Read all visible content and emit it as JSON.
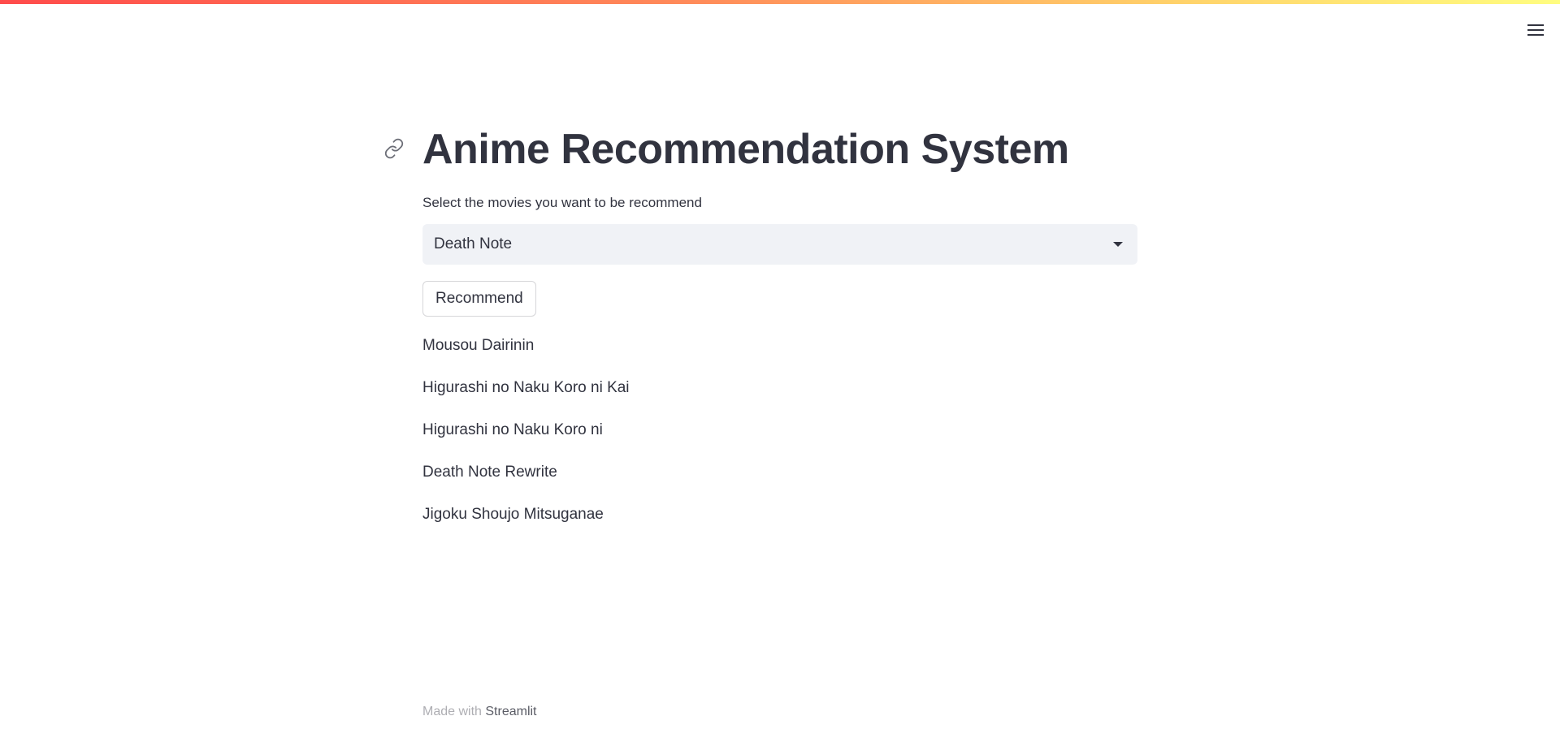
{
  "header": {
    "menu_icon": "hamburger-menu-icon",
    "gradient_colors": [
      "#ff4b4b",
      "#ff8c5a",
      "#ffd16a",
      "#fffd80"
    ]
  },
  "main": {
    "title": "Anime Recommendation System",
    "anchor_icon": "link-icon",
    "select_label": "Select the movies you want to be recommend",
    "select_value": "Death Note",
    "select_icon": "chevron-down-icon",
    "button_label": "Recommend",
    "results": [
      "Mousou Dairinin",
      "Higurashi no Naku Koro ni Kai",
      "Higurashi no Naku Koro ni",
      "Death Note Rewrite",
      "Jigoku Shoujo Mitsuganae"
    ]
  },
  "footer": {
    "prefix": "Made with",
    "link": "Streamlit"
  },
  "colors": {
    "text": "#31333F",
    "select_bg": "#F0F2F6",
    "background": "#ffffff"
  }
}
